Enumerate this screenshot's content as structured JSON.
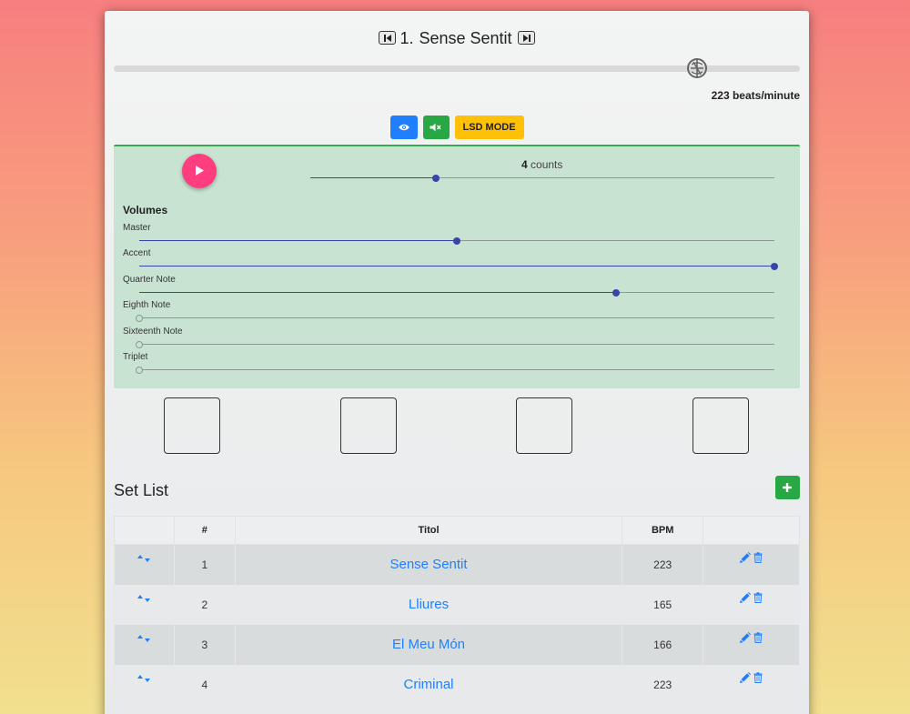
{
  "header": {
    "song_number": "1.",
    "song_title": "Sense Sentit",
    "prev_icon": "skip-previous-icon",
    "next_icon": "skip-next-icon"
  },
  "tempo": {
    "bpm_label": "223 beats/minute",
    "knob_icon": "metronome-dial-icon"
  },
  "toolbar": {
    "eye_icon": "eye-icon",
    "mute_icon": "speaker-mute-icon",
    "lsd_label": "LSD MODE",
    "colors": {
      "eye": "#1f7fff",
      "mute": "#28a745",
      "lsd": "#ffc107"
    }
  },
  "metronome": {
    "play_icon": "play-icon",
    "counts_value": "4",
    "counts_unit": "counts",
    "counts_slider_fraction": 0.27,
    "volumes_title": "Volumes",
    "volumes": [
      {
        "label": "Master",
        "fraction": 0.5
      },
      {
        "label": "Accent",
        "fraction": 1.0
      },
      {
        "label": "Quarter Note",
        "fraction": 0.75
      },
      {
        "label": "Eighth Note",
        "fraction": 0.0
      },
      {
        "label": "Sixteenth Note",
        "fraction": 0.0
      },
      {
        "label": "Triplet",
        "fraction": 0.0
      }
    ],
    "panel_color": "#c8e3d2",
    "play_color": "#ff3d7f"
  },
  "setlist": {
    "title": "Set List",
    "add_icon": "plus-icon",
    "columns": [
      "",
      "#",
      "Titol",
      "BPM",
      ""
    ],
    "rows": [
      {
        "num": "1",
        "title": "Sense Sentit",
        "bpm": "223"
      },
      {
        "num": "2",
        "title": "Lliures",
        "bpm": "165"
      },
      {
        "num": "3",
        "title": "El Meu Món",
        "bpm": "166"
      },
      {
        "num": "4",
        "title": "Criminal",
        "bpm": "223"
      }
    ],
    "row_icons": {
      "sort": "sort-arrows-icon",
      "edit": "pencil-icon",
      "delete": "trash-icon"
    }
  }
}
